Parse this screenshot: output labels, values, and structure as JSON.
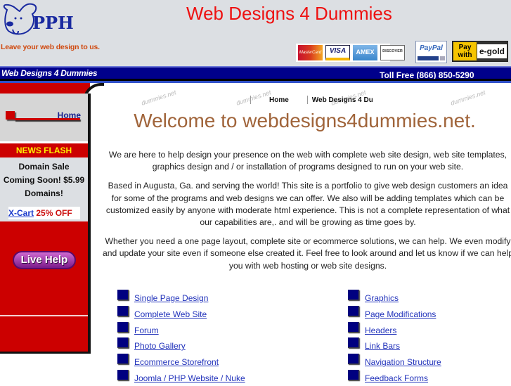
{
  "header": {
    "logo_text": "PPH",
    "tagline": "Leave your web design to us.",
    "site_title": "Web Designs 4 Dummies",
    "payment_logos": [
      "MasterCard",
      "VISA",
      "AMEX",
      "DISCOVER",
      "PayPal",
      "Pay with e-gold"
    ],
    "paypal_text": "PayPal",
    "egold_left": "Pay with",
    "egold_right": "e-gold",
    "visa_text": "VISA",
    "amex_text": "AMEX",
    "discover_text": "DISCOVER",
    "mastercard_text": "MasterCard"
  },
  "bluebar": {
    "title": "Web Designs 4 Dummies",
    "toll_free": "Toll Free (866) 850-5290"
  },
  "sidebar": {
    "home_label": "Home",
    "news_flash_title": "NEWS FLASH",
    "news_lines": [
      "Domain Sale",
      "Coming Soon! $5.99",
      "Domains!"
    ],
    "xcart_link": "X-Cart",
    "xcart_offer": "25% OFF",
    "live_help": "Live Help"
  },
  "breadcrumb": {
    "home": "Home",
    "current": "Web Designs 4 Du"
  },
  "watermark_text": "dummies.net",
  "main": {
    "welcome": "Welcome to webdesigns4dummies.net.",
    "paragraphs": [
      "We are here to help design your presence on the web with complete web site design, web site templates, graphics design and / or installation of programs designed to run on your web site.",
      "Based in Augusta, Ga. and serving the world! This site is a portfolio to give web design customers an idea for some of the programs and web designs we can offer. We also will be adding templates which can be customized easily by anyone with moderate html experience. This is not a complete representation of what our capabilities are,. and will be growing as time goes by.",
      "Whether you need a one page layout, complete site or ecommerce solutions, we can help. We even modify and update your site even if someone else created it. Feel free to look around and let us know if we can help you with web hosting or web site designs."
    ],
    "links_left": [
      "Single Page Design",
      "Complete Web Site",
      "Forum",
      "Photo Gallery",
      "Ecommerce Storefront",
      "Joomla / PHP Website / Nuke"
    ],
    "links_right": [
      "Graphics",
      "Page Modifications",
      "Headers",
      "Link Bars",
      "Navigation Structure",
      "Feedback Forms"
    ]
  },
  "colors": {
    "title_red": "#ee1111",
    "navy": "#00008b",
    "sidebar_red": "#cc0000",
    "welcome_brown": "#a0643a",
    "link_blue": "#2233bb",
    "news_yellow": "#ffee00"
  }
}
